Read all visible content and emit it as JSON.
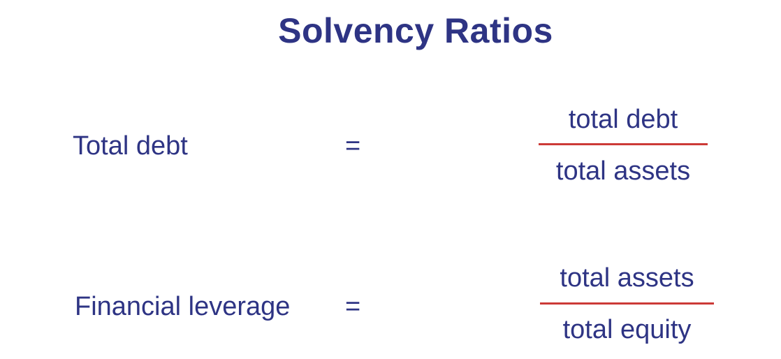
{
  "title": "Solvency Ratios",
  "colors": {
    "text": "#2e3484",
    "fraction_bar": "#cc3a37",
    "background": "#ffffff"
  },
  "ratios": [
    {
      "label": "Total debt",
      "equals": "=",
      "numerator": "total debt",
      "denominator": "total assets"
    },
    {
      "label": "Financial leverage",
      "equals": "=",
      "numerator": "total assets",
      "denominator": "total equity"
    }
  ]
}
